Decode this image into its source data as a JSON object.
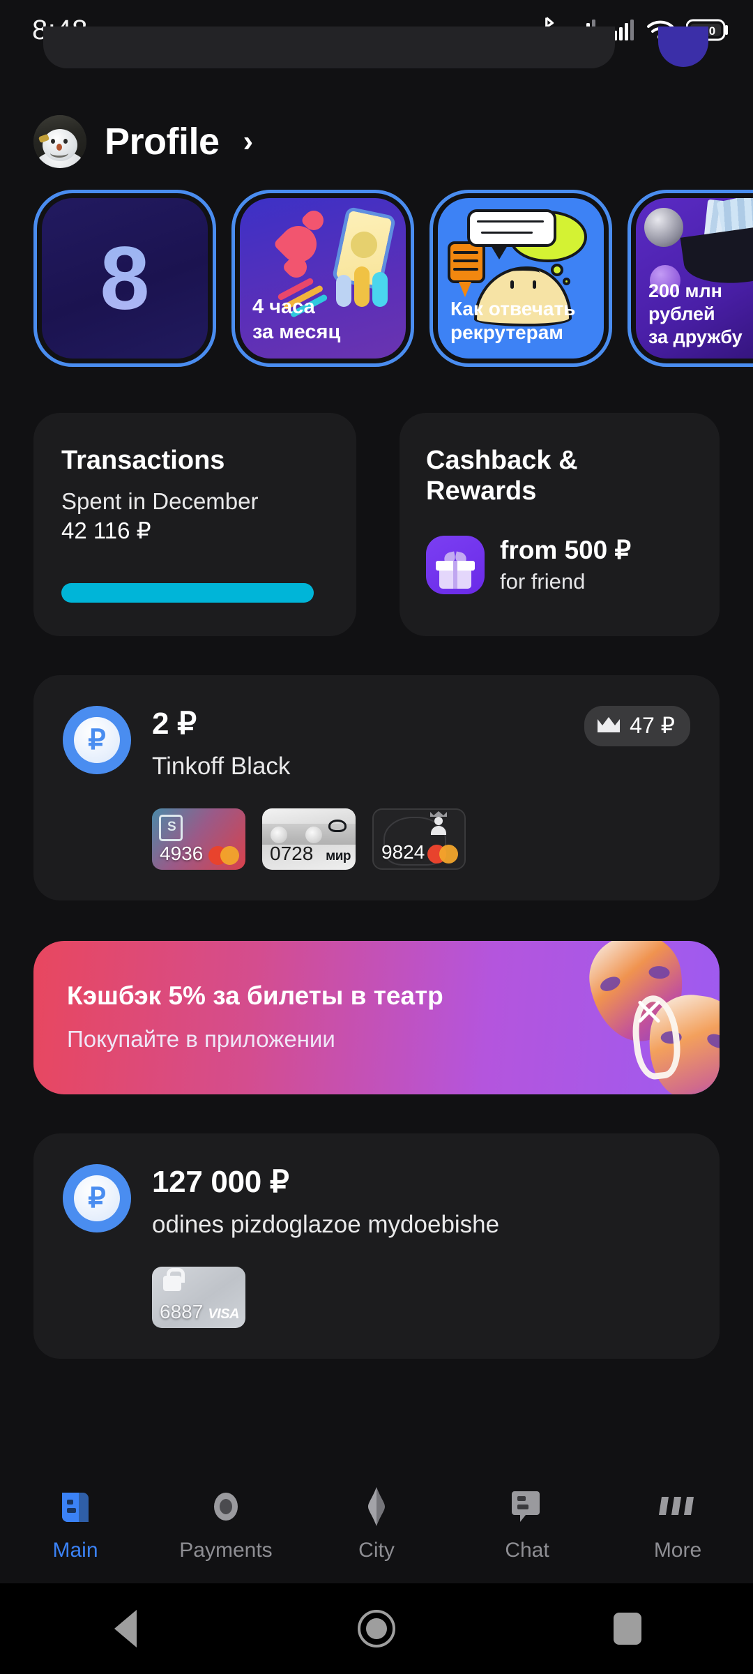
{
  "status_bar": {
    "time": "8:48",
    "battery_level": "100",
    "icons": [
      "bluetooth-icon",
      "signal-1-icon",
      "signal-2-icon",
      "wifi-icon",
      "battery-icon"
    ]
  },
  "profile": {
    "title": "Profile",
    "chevron": "›"
  },
  "stories": [
    {
      "label": "",
      "number": "8",
      "art": "number-badge"
    },
    {
      "label": "4 часа\nза месяц",
      "art": "phone-hearts"
    },
    {
      "label": "Как отвечать\nрекрутерам",
      "art": "blob-speech"
    },
    {
      "label": "200 млн\nрублей\nза дружбу",
      "art": "hat-cash"
    }
  ],
  "transactions": {
    "title": "Transactions",
    "subtitle": "Spent in December",
    "amount": "42 116 ₽",
    "progress_color": "#00b5d8",
    "progress_percent": "100"
  },
  "cashback": {
    "title": "Cashback &\nRewards",
    "offer_amount": "from 500 ₽",
    "offer_sub": "for friend",
    "icon_color": "#6a2ae8"
  },
  "accounts": [
    {
      "balance": "2 ₽",
      "name": "Tinkoff Black",
      "bonus_badge": "47 ₽",
      "cards": [
        {
          "last4": "4936",
          "network": "mastercard",
          "style": "gradient-red"
        },
        {
          "last4": "0728",
          "network": "мир",
          "style": "silver"
        },
        {
          "last4": "9824",
          "network": "mastercard",
          "style": "dark-crest"
        }
      ]
    },
    {
      "balance": "127 000 ₽",
      "name": "odines pizdoglazoe mydoebishe",
      "bonus_badge": "",
      "cards": [
        {
          "last4": "6887",
          "network": "VISA",
          "style": "locked-silver"
        }
      ]
    }
  ],
  "promo": {
    "title": "Кэшбэк 5% за билеты в театр",
    "subtitle": "Покупайте в приложении",
    "gradient_from": "#e8475f",
    "gradient_to": "#9e5bf0",
    "close_label": "×"
  },
  "bottom_nav": {
    "active": "Main",
    "items": [
      {
        "label": "Main",
        "icon": "main-icon"
      },
      {
        "label": "Payments",
        "icon": "payments-icon"
      },
      {
        "label": "City",
        "icon": "city-icon"
      },
      {
        "label": "Chat",
        "icon": "chat-icon"
      },
      {
        "label": "More",
        "icon": "more-icon"
      }
    ]
  },
  "android_nav": {
    "back": "back-button",
    "home": "home-button",
    "recents": "recents-button"
  }
}
